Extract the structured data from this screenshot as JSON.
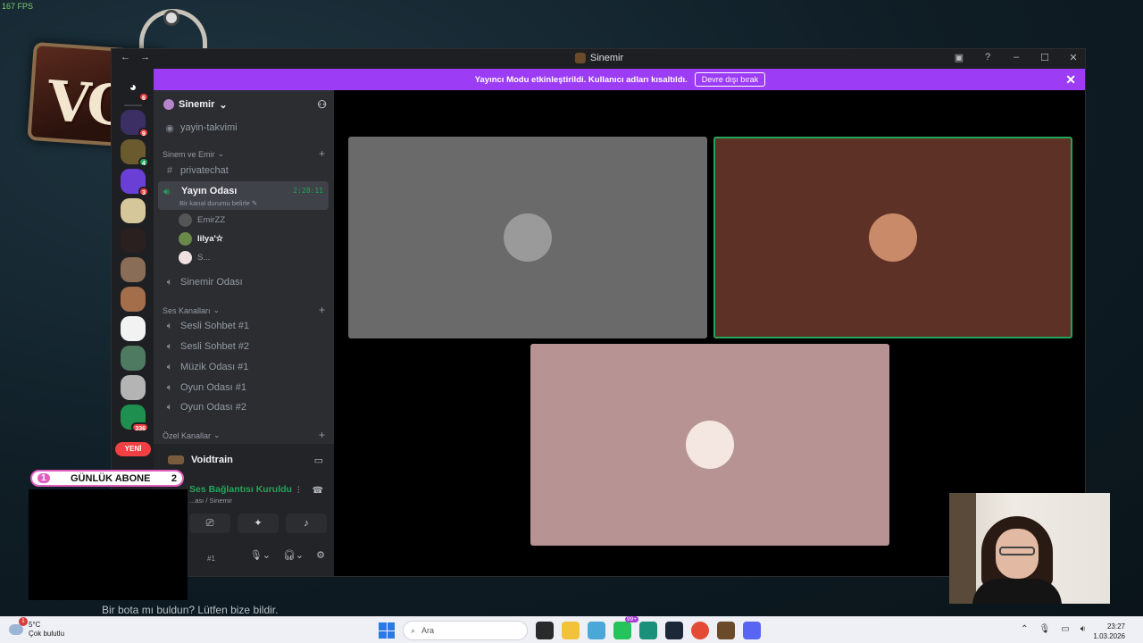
{
  "overlay": {
    "fps": "167 FPS",
    "game_logo": "VO",
    "bot_prompt": "Bir bota mı buldun? Lütfen bize bildir.",
    "sub_counter": {
      "left": "1",
      "label": "GÜNLÜK ABONE",
      "right": "2"
    }
  },
  "window": {
    "title": "Sinemir",
    "nav_back": "←",
    "nav_forward": "→",
    "controls": {
      "screen": "▣",
      "help": "?",
      "minimize": "–",
      "maximize": "☐",
      "close": "✕"
    }
  },
  "rail": {
    "home_badge": "6",
    "items": [
      {
        "name": "server-1",
        "badge": "9",
        "color": "#3b2f63"
      },
      {
        "name": "server-2",
        "badge": "4",
        "color": "#6b5a2e",
        "badge_color": "green"
      },
      {
        "name": "server-3",
        "badge": "3",
        "color": "#6a3fd6"
      },
      {
        "name": "server-4",
        "badge": "",
        "color": "#d6c79b"
      },
      {
        "name": "server-5",
        "badge": "",
        "color": "#2a2020"
      },
      {
        "name": "server-6",
        "badge": "",
        "color": "#8a6d57"
      },
      {
        "name": "server-7",
        "badge": "",
        "color": "#a46e4a"
      },
      {
        "name": "server-8",
        "badge": "",
        "color": "#f2f2f2"
      },
      {
        "name": "server-9",
        "badge": "",
        "color": "#4f7a62"
      },
      {
        "name": "server-10",
        "badge": "",
        "color": "#b4b4b4"
      },
      {
        "name": "server-11",
        "badge": "336",
        "color": "#1f8f4f"
      }
    ],
    "new_label": "YENİ"
  },
  "banner": {
    "text": "Yayıncı Modu etkinleştirildi. Kullanıcı adları kısaltıldı.",
    "button": "Devre dışı bırak",
    "close": "✕"
  },
  "sidebar": {
    "server_name": "Sinemir",
    "channels_top": [
      {
        "label": "yayin-takvimi",
        "icon": "◉"
      }
    ],
    "cat1": "Sinem ve Emir",
    "privatechat": "privatechat",
    "active_voice": {
      "name": "Yayın Odası",
      "status": "Bir kanal durumu belirle ✎",
      "time": "2:28:11"
    },
    "members": [
      {
        "name": "EmirZZ",
        "color": "#555"
      },
      {
        "name": "lilya'✫",
        "color": "#6b8a4a",
        "bold": true
      },
      {
        "name": "S...",
        "color": "#f1e0e0"
      }
    ],
    "sinemir_room": "Sinemir Odası",
    "cat2": "Ses Kanalları",
    "voice_channels": [
      "Sesli Sohbet #1",
      "Sesli Sohbet #2",
      "Müzik Odası #1",
      "Oyun Odası #1",
      "Oyun Odası #2"
    ],
    "cat3": "Özel Kanallar"
  },
  "user_panel": {
    "server": "Voidtrain",
    "conn_status": "Ses Bağlantısı Kuruldu",
    "conn_sub": "...ası / Sinemir",
    "user_suffix": "#1"
  },
  "stage": {
    "tiles": [
      {
        "name": "video-tile-1",
        "color": "#6a6a6a",
        "avatar": "#9a9a9a",
        "speaking": false
      },
      {
        "name": "video-tile-2",
        "color": "#5e3127",
        "avatar": "#c98a6a",
        "speaking": true
      },
      {
        "name": "video-tile-3",
        "color": "#b89393",
        "avatar": "#f4e6e0",
        "speaking": false
      }
    ]
  },
  "taskbar": {
    "weather_temp": "5°C",
    "weather_desc": "Çok bulutlu",
    "weather_badge": "1",
    "search": "Ara",
    "badge_99": "99+",
    "time": "23:27",
    "date": "1.03.2026"
  }
}
